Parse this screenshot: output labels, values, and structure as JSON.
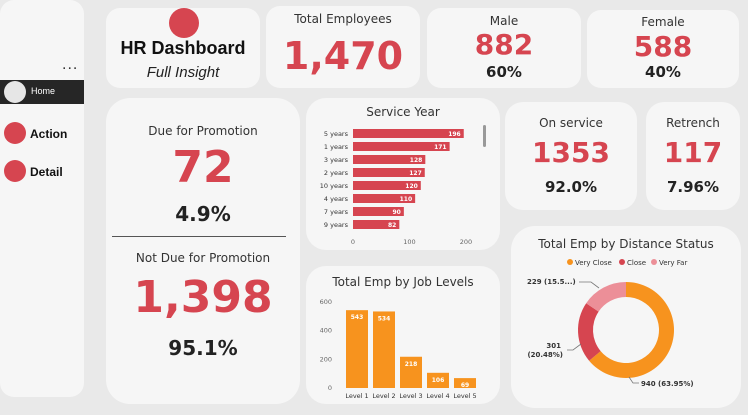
{
  "sidebar": {
    "more_label": "...",
    "items": [
      {
        "label": "Home"
      },
      {
        "label": "Action"
      },
      {
        "label": "Detail"
      }
    ]
  },
  "header": {
    "title": "HR Dashboard",
    "subtitle": "Full Insight"
  },
  "kpis": {
    "total_employees": {
      "label": "Total Employees",
      "value": "1,470"
    },
    "male": {
      "label": "Male",
      "value": "882",
      "pct": "60%"
    },
    "female": {
      "label": "Female",
      "value": "588",
      "pct": "40%"
    },
    "promotion": {
      "label": "Due for Promotion",
      "value": "72",
      "pct": "4.9%"
    },
    "not_promotion": {
      "label": "Not Due for Promotion",
      "value": "1,398",
      "pct": "95.1%"
    },
    "on_service": {
      "label": "On service",
      "value": "1353",
      "pct": "92.0%"
    },
    "retrench": {
      "label": "Retrench",
      "value": "117",
      "pct": "7.96%"
    }
  },
  "colors": {
    "accent": "#d64550",
    "orange": "#f7931e",
    "pink": "#ec8f98",
    "card": "#f6f6f6",
    "bg": "#e9e9e9"
  },
  "chart_data": [
    {
      "type": "bar",
      "orientation": "horizontal",
      "title": "Service Year",
      "categories": [
        "5 years",
        "1 years",
        "3 years",
        "2 years",
        "10 years",
        "4 years",
        "7 years",
        "9 years"
      ],
      "values": [
        196,
        171,
        128,
        127,
        120,
        110,
        90,
        82
      ],
      "xticks": [
        "0",
        "100",
        "200"
      ],
      "xlim": [
        0,
        200
      ],
      "color": "#d64550"
    },
    {
      "type": "bar",
      "title": "Total Emp by Job Levels",
      "categories": [
        "Level 1",
        "Level 2",
        "Level 3",
        "Level 4",
        "Level 5"
      ],
      "values": [
        543,
        534,
        218,
        106,
        69
      ],
      "yticks": [
        "0",
        "200",
        "400",
        "600"
      ],
      "ylim": [
        0,
        600
      ],
      "color": "#f7931e"
    },
    {
      "type": "pie",
      "title": "Total Emp by Distance Status",
      "legend": [
        "Very Close",
        "Close",
        "Very Far"
      ],
      "values": [
        940,
        301,
        229
      ],
      "slice_labels": [
        "940 (63.95%)",
        "301 (20.48%)",
        "229 (15.5...)"
      ],
      "colors": [
        "#f7931e",
        "#d64550",
        "#ec8f98"
      ]
    }
  ]
}
